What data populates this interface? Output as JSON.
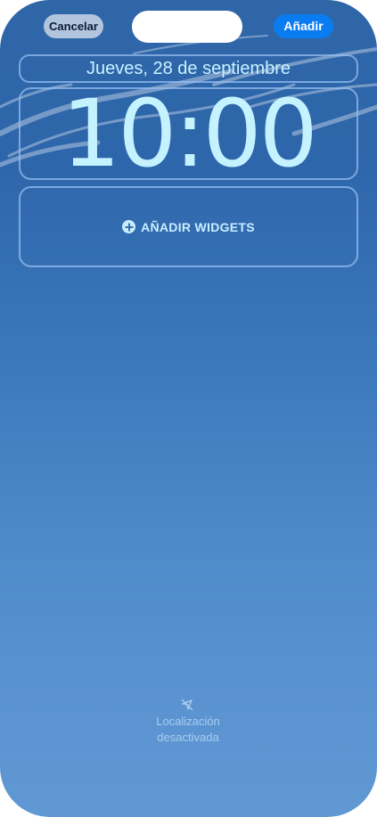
{
  "header": {
    "cancel_label": "Cancelar",
    "add_label": "Añadir"
  },
  "lockscreen": {
    "date": "Jueves, 28 de septiembre",
    "time": "10:00",
    "add_widgets_label": "AÑADIR WIDGETS"
  },
  "location": {
    "icon": "location-off-icon",
    "line1": "Localización",
    "line2": "desactivada"
  },
  "colors": {
    "accent": "#0a7cf2",
    "clock_text": "#c4f3ff",
    "frame": "#96bef0"
  }
}
